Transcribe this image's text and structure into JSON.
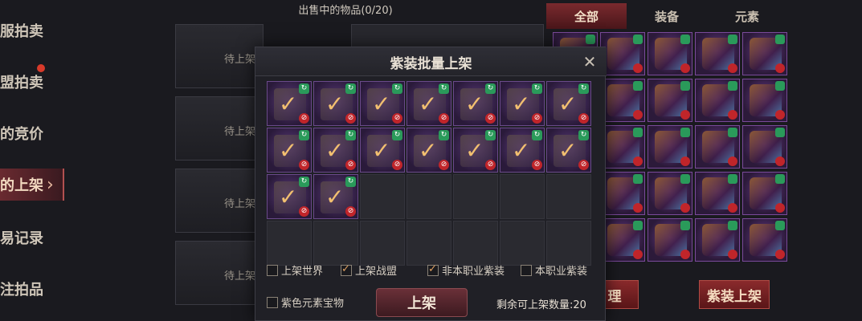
{
  "left_nav": [
    {
      "label": "服拍卖",
      "active": false
    },
    {
      "label": "盟拍卖",
      "active": false
    },
    {
      "label": "的竞价",
      "active": false
    },
    {
      "label": "的上架",
      "active": true
    },
    {
      "label": "易记录",
      "active": false
    },
    {
      "label": "注拍品",
      "active": false
    }
  ],
  "middle": {
    "title": "出售中的物品(0/20)",
    "slot_label": "待上架"
  },
  "tabs": [
    {
      "label": "全部",
      "active": true
    },
    {
      "label": "装备",
      "active": false
    },
    {
      "label": "元素",
      "active": false
    }
  ],
  "right_buttons": {
    "left_partial": "理",
    "bulk_list": "紫装上架"
  },
  "modal": {
    "title": "紫装批量上架",
    "close_icon": "close-x-icon",
    "checked_item_count": 16,
    "total_slots": 28,
    "options": [
      {
        "label": "上架世界",
        "checked": false
      },
      {
        "label": "上架战盟",
        "checked": true
      },
      {
        "label": "非本职业紫装",
        "checked": true
      },
      {
        "label": "本职业紫装",
        "checked": false
      },
      {
        "label": "紫色元素宝物",
        "checked": false
      }
    ],
    "list_button": "上架",
    "remaining": "剩余可上架数量:20"
  },
  "colors": {
    "accent_red": "#8a2a2c",
    "purple_item": "#5a3a7a",
    "check_gold": "#f2c070",
    "cycle_green": "#2a9a5a",
    "ban_red": "#c0252a"
  }
}
